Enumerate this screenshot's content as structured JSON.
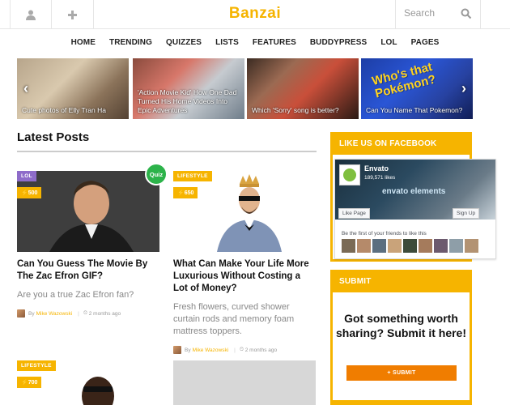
{
  "header": {
    "logo": "Banzai",
    "search_placeholder": "Search",
    "user_icon": "user-icon",
    "plus_icon": "plus-icon"
  },
  "nav": [
    "HOME",
    "TRENDING",
    "QUIZZES",
    "LISTS",
    "FEATURES",
    "BUDDYPRESS",
    "LOL",
    "PAGES"
  ],
  "slider": {
    "slides": [
      {
        "caption": "Cute photos of Elly Tran Ha"
      },
      {
        "caption": "'Action Movie Kid' How One Dad Turned His Home Videos Into Epic Adventures"
      },
      {
        "caption": "Which 'Sorry' song is better?"
      },
      {
        "caption": "Can You Name That Pokemon?",
        "image_text": "Who's that Pokémon?"
      }
    ]
  },
  "latest": {
    "title": "Latest Posts",
    "posts": [
      {
        "category": "LOL",
        "category_color": "#8e6cc9",
        "count": "500",
        "quiz": "Quiz",
        "title": "Can You Guess The Movie By The Zac Efron GIF?",
        "excerpt": "Are you a true Zac Efron fan?",
        "by": "By",
        "author": "Mike Wazowski",
        "time": "2 months ago"
      },
      {
        "category": "LIFESTYLE",
        "category_color": "#f6b400",
        "count": "650",
        "title": "What Can Make Your Life More Luxurious Without Costing a Lot of Money?",
        "excerpt": "Fresh flowers, curved shower curtain rods and memory foam mattress toppers.",
        "by": "By",
        "author": "Mike Wazowski",
        "time": "2 months ago"
      },
      {
        "category": "LIFESTYLE",
        "category_color": "#f6b400",
        "count": "700"
      },
      {}
    ]
  },
  "sidebar": {
    "facebook_title": "LIKE US ON FACEBOOK",
    "fb_page_name": "Envato",
    "fb_likes": "189,571 likes",
    "fb_cover_text": "envato elements",
    "fb_like_button": "Like Page",
    "fb_signup": "Sign Up",
    "fb_first": "Be the first of your friends to like this",
    "submit_title": "SUBMIT",
    "submit_text": "Got something worth sharing? Submit it here!",
    "submit_button": "+ SUBMIT"
  },
  "colors": {
    "accent": "#f6b400",
    "orange_button": "#f07d00",
    "quiz_green": "#2cb34a",
    "lol_purple": "#8e6cc9"
  }
}
